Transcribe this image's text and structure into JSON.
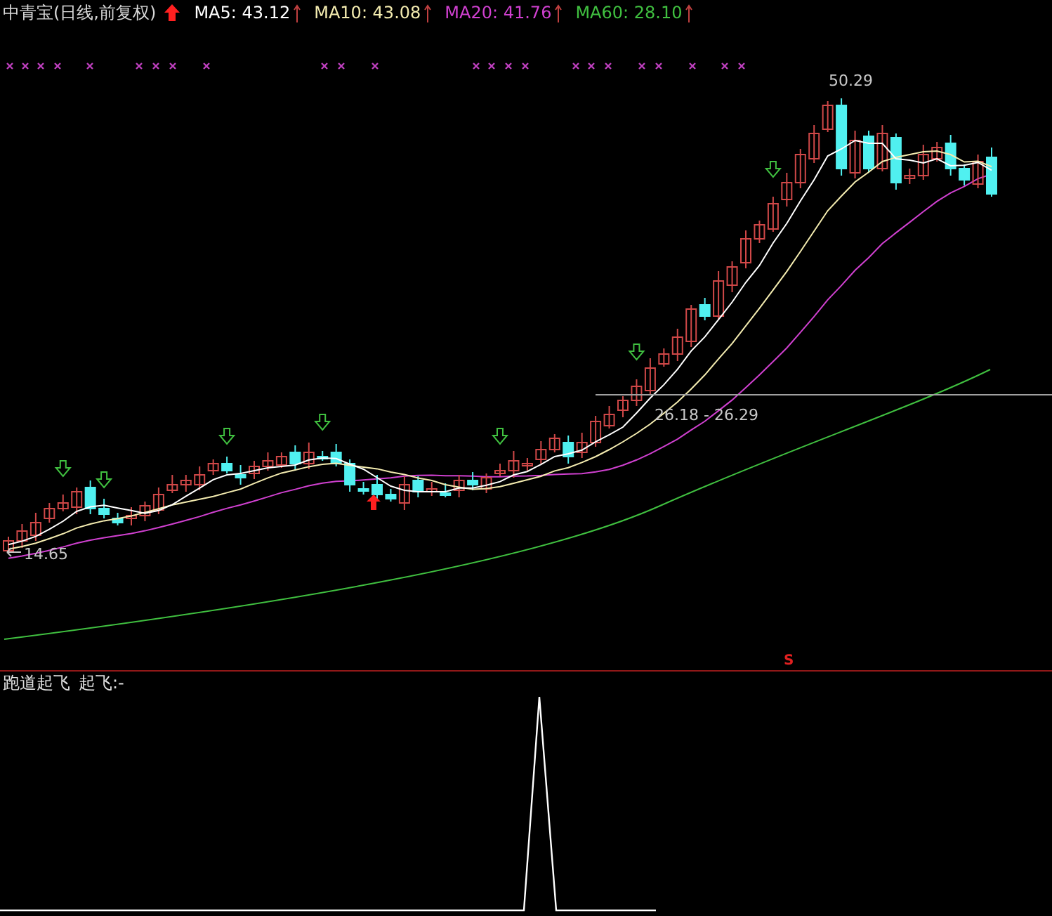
{
  "chart": {
    "title": "中青宝(日线,前复权)",
    "indicators": [
      {
        "label": "MA5: 43.12",
        "color": "#ffffff"
      },
      {
        "label": "MA10: 43.08",
        "color": "#f4ecb0"
      },
      {
        "label": "MA20: 41.76",
        "color": "#d040d0"
      },
      {
        "label": "MA60: 28.10",
        "color": "#40c040"
      }
    ],
    "high_label": "50.29",
    "low_label": "14.65",
    "range_label": "26.18 - 26.29",
    "signal": "S"
  },
  "sub_chart": {
    "title": "跑道起飞",
    "reading": "起飞:-"
  }
}
